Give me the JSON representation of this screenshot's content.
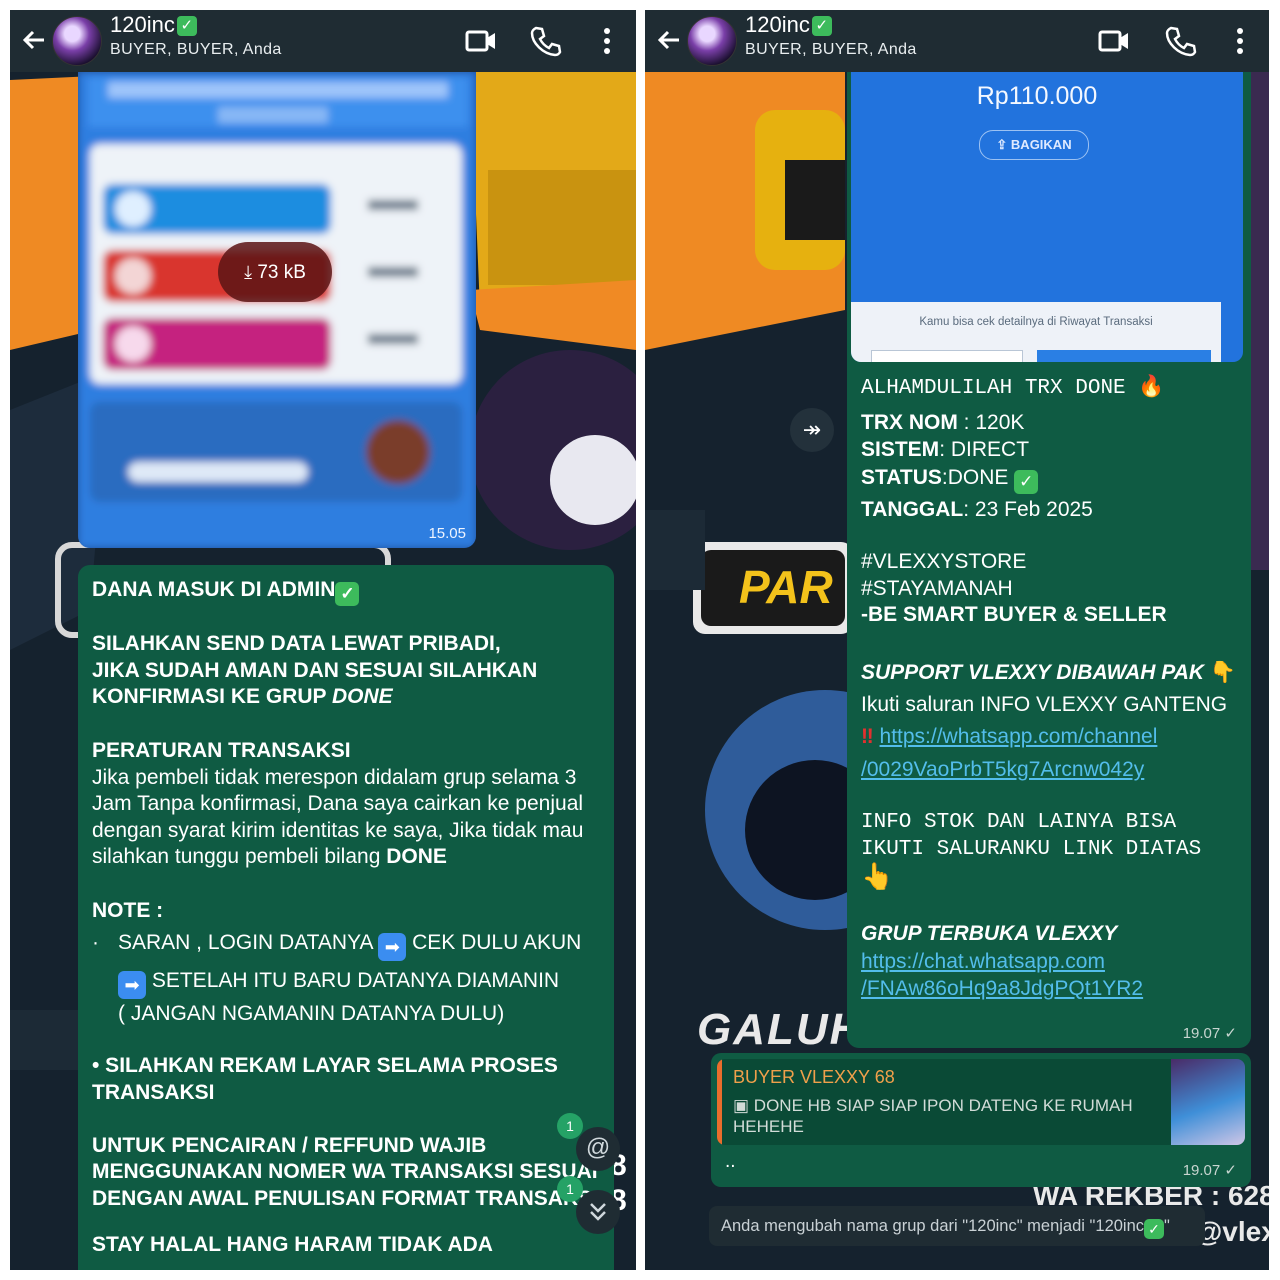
{
  "left": {
    "header": {
      "title": "120inc",
      "participants": "BUYER, BUYER, Anda"
    },
    "image_message": {
      "download_size": "73 kB",
      "time": "15.05"
    },
    "text_message": {
      "line1": "DANA MASUK DI ADMIN",
      "p1_l1": "SILAHKAN SEND DATA LEWAT PRIBADI,",
      "p1_l2": "JIKA SUDAH AMAN DAN SESUAI SILAHKAN",
      "p1_l3a": "KONFIRMASI KE GRUP ",
      "p1_l3b": "DONE",
      "rules_title": "PERATURAN TRANSAKSI",
      "rules_l1": "Jika pembeli tidak merespon didalam grup selama 3",
      "rules_l2": "Jam Tanpa konfirmasi, Dana saya cairkan ke penjual",
      "rules_l3": "dengan syarat kirim identitas ke saya, Jika tidak mau",
      "rules_l4a": "silahkan tunggu pembeli bilang ",
      "rules_l4b": "DONE",
      "note_title": "NOTE :",
      "note_bullet": "·",
      "note_l1a": "SARAN , LOGIN DATANYA",
      "note_l1b": "CEK DULU AKUN",
      "note_l2": "SETELAH ITU BARU DATANYA DIAMANIN",
      "note_l3": "( JANGAN NGAMANIN DATANYA DULU)",
      "record_l1": "• SILAHKAN REKAM LAYAR SELAMA PROSES",
      "record_l2": "TRANSAKSI",
      "refund_l1": "UNTUK PENCAIRAN / REFFUND WAJIB",
      "refund_l2": "MENGGUNAKAN NOMER WA TRANSAKSI SESUAI",
      "refund_l3": "DENGAN AWAL PENULISAN FORMAT TRANSAKSI",
      "cut_line": "STAY HALAL HANG HARAM TIDAK ADA"
    },
    "mention_badge": "1",
    "scroll_badge": "1"
  },
  "right": {
    "header": {
      "title": "120inc",
      "participants": "BUYER, BUYER, Anda"
    },
    "image_message": {
      "amount": "Rp110.000",
      "share_label": "BAGIKAN",
      "detail_text": "Kamu bisa cek detailnya di Riwayat Transaksi"
    },
    "text_message": {
      "l1": "ALHAMDULILAH TRX DONE",
      "trx_label": "TRX NOM",
      "trx_value": " : 120K",
      "sistem_label": "SISTEM",
      "sistem_value": ": DIRECT",
      "status_label": "STATUS",
      "status_value": ":DONE",
      "tanggal_label": "TANGGAL",
      "tanggal_value": ": 23 Feb 2025",
      "tag1": "#VLEXXYSTORE",
      "tag2": "#STAYAMANAH",
      "tag3": "-BE SMART BUYER & SELLER",
      "support": "SUPPORT VLEXXY DIBAWAH PAK",
      "ikuti": "Ikuti saluran INFO VLEXXY GANTENG",
      "link1a": "https://whatsapp.com/channel",
      "link1b": "/0029VaoPrbT5kg7Arcnw042y",
      "info1": "INFO STOK DAN LAINYA BISA",
      "info2": "IKUTI SALURANKU LINK DIATAS",
      "grup": "GRUP TERBUKA VLEXXY",
      "link2a": "https://chat.whatsapp.com",
      "link2b": "/FNAw86oHq9a8JdgPQt1YR2",
      "time": "19.07"
    },
    "reply_message": {
      "quoted_author": "BUYER VLEXXY 68",
      "quoted_l1": "DONE HB SIAP SIAP IPON DATENG KE RUMAH",
      "quoted_l2": "HEHEHE",
      "text": "..",
      "time": "19.07"
    },
    "system_message": "Anda mengubah nama grup dari \"120inc\" menjadi \"120inc",
    "system_suffix": "\"",
    "background_texts": {
      "galuh": "GALUH",
      "par": "PAR",
      "rekber": "WA REKBER : 628",
      "vlex": "@vlex"
    }
  },
  "colors": {
    "bubble": "#0f5b43",
    "header": "#1f2c33",
    "link": "#53bdeb",
    "badge": "#25a266"
  }
}
